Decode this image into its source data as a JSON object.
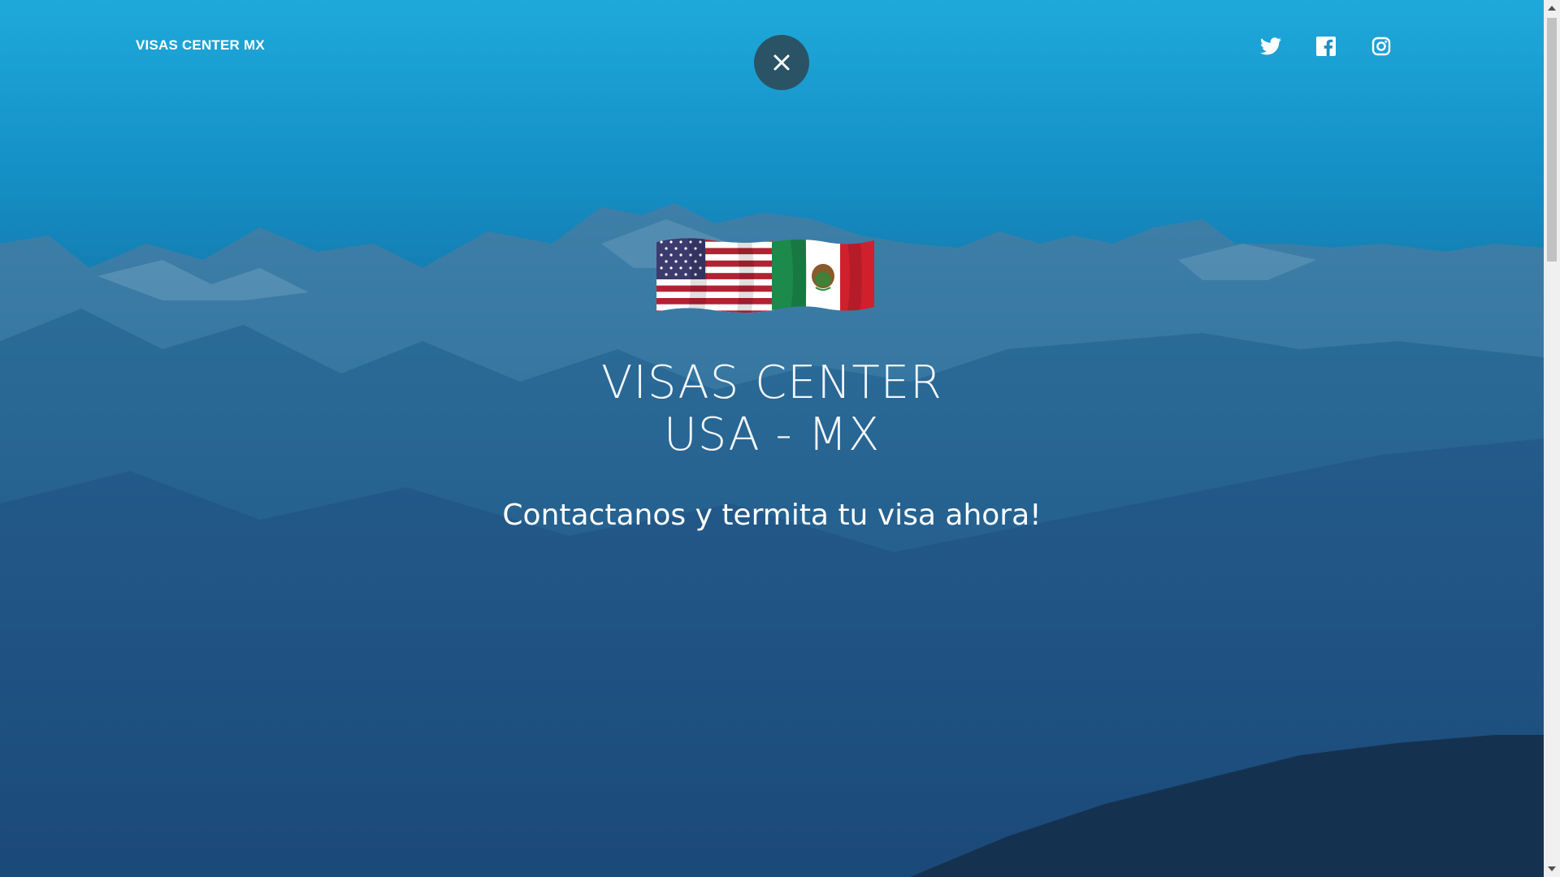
{
  "header": {
    "brand": "VISAS CENTER MX",
    "close_icon": "close-icon",
    "social": [
      {
        "name": "twitter",
        "icon": "twitter-icon"
      },
      {
        "name": "facebook",
        "icon": "facebook-icon"
      },
      {
        "name": "instagram",
        "icon": "instagram-icon"
      }
    ]
  },
  "hero": {
    "title_line1": "VISAS CENTER",
    "title_line2": "USA - MX",
    "tagline": "Contactanos y termita tu visa ahora!",
    "flags": [
      "us-flag",
      "mexico-flag"
    ]
  },
  "colors": {
    "sky_top": "#1fa9db",
    "mountain_dark": "#163a5c",
    "close_button": "#2a5466",
    "text": "#ffffff"
  }
}
